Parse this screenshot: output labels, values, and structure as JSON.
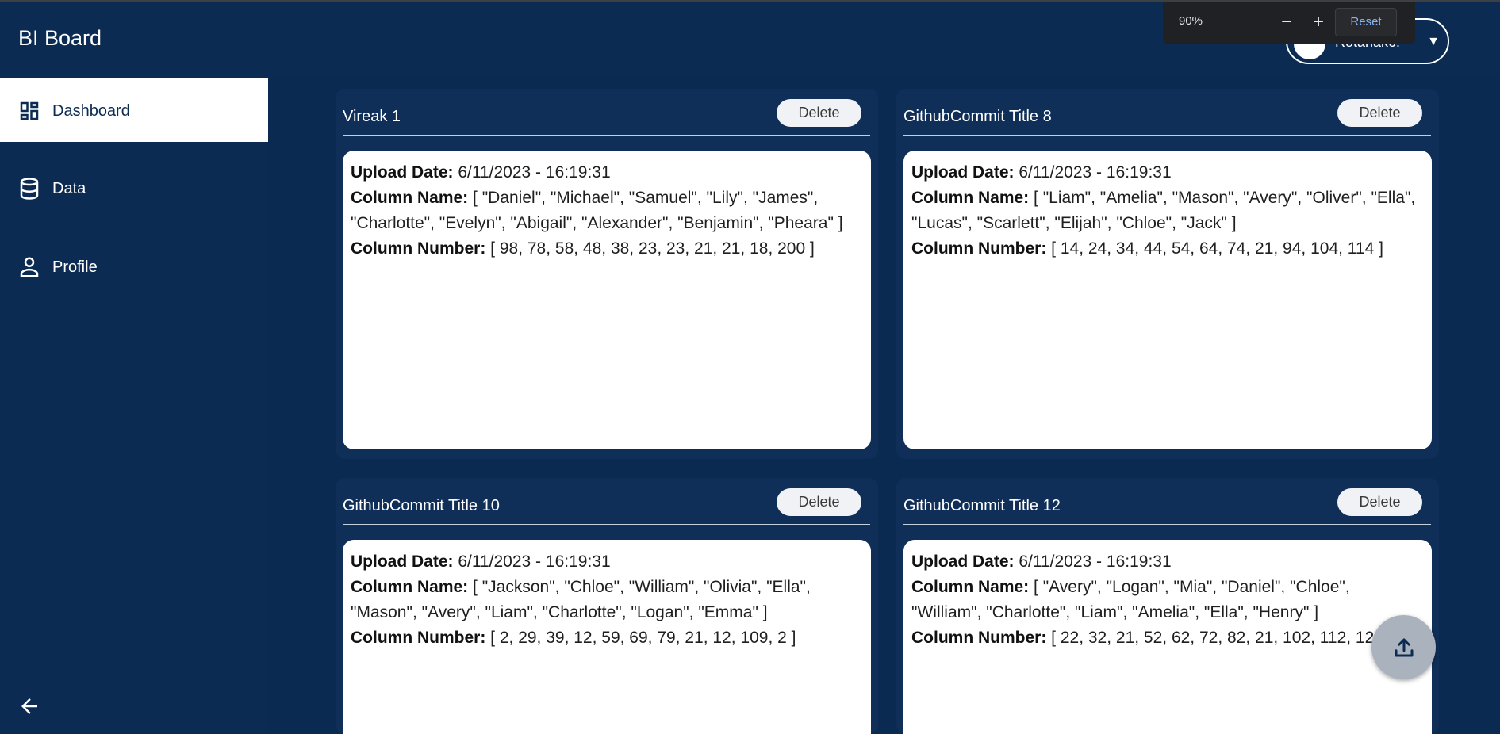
{
  "app": {
    "title": "BI Board"
  },
  "account": {
    "name": "Rotanak6!"
  },
  "zoom": {
    "level": "90%",
    "minus": "−",
    "plus": "+",
    "reset": "Reset"
  },
  "sidebar": {
    "items": [
      {
        "label": "Dashboard",
        "icon": "dashboard-icon",
        "active": true
      },
      {
        "label": "Data",
        "icon": "database-icon"
      },
      {
        "label": "Profile",
        "icon": "person-icon"
      }
    ],
    "collapse_icon": "arrow-left-icon"
  },
  "cards": [
    {
      "title": "Vireak 1",
      "delete_label": "Delete",
      "upload_label": "Upload Date:",
      "upload_value": "6/11/2023 - 16:19:31",
      "colname_label": "Column Name:",
      "colname_value": "[ \"Daniel\", \"Michael\", \"Samuel\", \"Lily\", \"James\", \"Charlotte\", \"Evelyn\", \"Abigail\", \"Alexander\", \"Benjamin\", \"Pheara\" ]",
      "colnum_label": "Column Number:",
      "colnum_value": "[ 98, 78, 58, 48, 38, 23, 23, 21, 21, 18, 200 ]"
    },
    {
      "title": "GithubCommit Title 8",
      "delete_label": "Delete",
      "upload_label": "Upload Date:",
      "upload_value": "6/11/2023 - 16:19:31",
      "colname_label": "Column Name:",
      "colname_value": "[ \"Liam\", \"Amelia\", \"Mason\", \"Avery\", \"Oliver\", \"Ella\", \"Lucas\", \"Scarlett\", \"Elijah\", \"Chloe\", \"Jack\" ]",
      "colnum_label": "Column Number:",
      "colnum_value": "[ 14, 24, 34, 44, 54, 64, 74, 21, 94, 104, 114 ]"
    },
    {
      "title": "GithubCommit Title 10",
      "delete_label": "Delete",
      "upload_label": "Upload Date:",
      "upload_value": "6/11/2023 - 16:19:31",
      "colname_label": "Column Name:",
      "colname_value": "[ \"Jackson\", \"Chloe\", \"William\", \"Olivia\", \"Ella\", \"Mason\", \"Avery\", \"Liam\", \"Charlotte\", \"Logan\", \"Emma\" ]",
      "colnum_label": "Column Number:",
      "colnum_value": "[ 2, 29, 39, 12, 59, 69, 79, 21, 12, 109, 2 ]"
    },
    {
      "title": "GithubCommit Title 12",
      "delete_label": "Delete",
      "upload_label": "Upload Date:",
      "upload_value": "6/11/2023 - 16:19:31",
      "colname_label": "Column Name:",
      "colname_value": "[ \"Avery\", \"Logan\", \"Mia\", \"Daniel\", \"Chloe\", \"William\", \"Charlotte\", \"Liam\", \"Amelia\", \"Ella\", \"Henry\" ]",
      "colnum_label": "Column Number:",
      "colnum_value": "[ 22, 32, 21, 52, 62, 72, 82, 21, 102, 112, 122 ]"
    }
  ],
  "fab": {
    "icon": "upload-icon"
  },
  "colors": {
    "background": "#0b2a52",
    "card": "#0f2f59",
    "active_nav": "#ffffff",
    "fab": "#a9b2bd"
  }
}
